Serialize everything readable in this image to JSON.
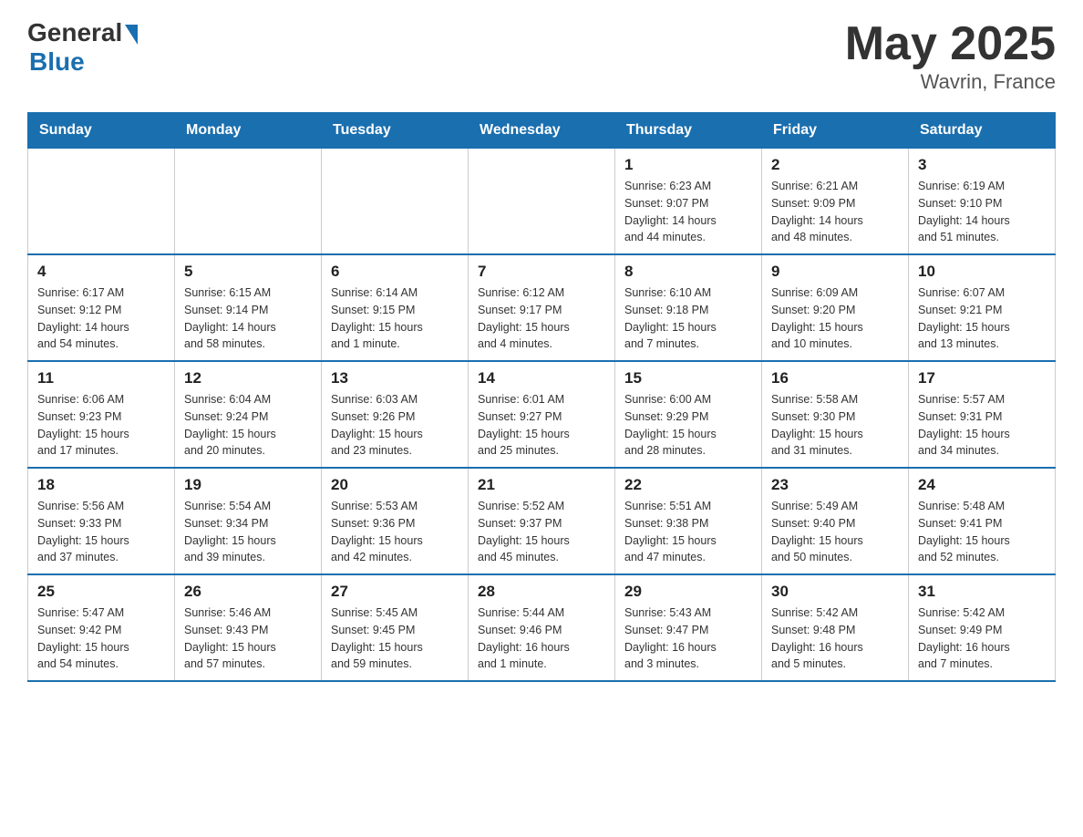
{
  "header": {
    "logo": {
      "general_text": "General",
      "blue_text": "Blue",
      "subtitle": "Blue"
    },
    "title": "May 2025",
    "location": "Wavrin, France"
  },
  "days_of_week": [
    "Sunday",
    "Monday",
    "Tuesday",
    "Wednesday",
    "Thursday",
    "Friday",
    "Saturday"
  ],
  "weeks": [
    {
      "days": [
        {
          "number": "",
          "info": ""
        },
        {
          "number": "",
          "info": ""
        },
        {
          "number": "",
          "info": ""
        },
        {
          "number": "",
          "info": ""
        },
        {
          "number": "1",
          "info": "Sunrise: 6:23 AM\nSunset: 9:07 PM\nDaylight: 14 hours\nand 44 minutes."
        },
        {
          "number": "2",
          "info": "Sunrise: 6:21 AM\nSunset: 9:09 PM\nDaylight: 14 hours\nand 48 minutes."
        },
        {
          "number": "3",
          "info": "Sunrise: 6:19 AM\nSunset: 9:10 PM\nDaylight: 14 hours\nand 51 minutes."
        }
      ]
    },
    {
      "days": [
        {
          "number": "4",
          "info": "Sunrise: 6:17 AM\nSunset: 9:12 PM\nDaylight: 14 hours\nand 54 minutes."
        },
        {
          "number": "5",
          "info": "Sunrise: 6:15 AM\nSunset: 9:14 PM\nDaylight: 14 hours\nand 58 minutes."
        },
        {
          "number": "6",
          "info": "Sunrise: 6:14 AM\nSunset: 9:15 PM\nDaylight: 15 hours\nand 1 minute."
        },
        {
          "number": "7",
          "info": "Sunrise: 6:12 AM\nSunset: 9:17 PM\nDaylight: 15 hours\nand 4 minutes."
        },
        {
          "number": "8",
          "info": "Sunrise: 6:10 AM\nSunset: 9:18 PM\nDaylight: 15 hours\nand 7 minutes."
        },
        {
          "number": "9",
          "info": "Sunrise: 6:09 AM\nSunset: 9:20 PM\nDaylight: 15 hours\nand 10 minutes."
        },
        {
          "number": "10",
          "info": "Sunrise: 6:07 AM\nSunset: 9:21 PM\nDaylight: 15 hours\nand 13 minutes."
        }
      ]
    },
    {
      "days": [
        {
          "number": "11",
          "info": "Sunrise: 6:06 AM\nSunset: 9:23 PM\nDaylight: 15 hours\nand 17 minutes."
        },
        {
          "number": "12",
          "info": "Sunrise: 6:04 AM\nSunset: 9:24 PM\nDaylight: 15 hours\nand 20 minutes."
        },
        {
          "number": "13",
          "info": "Sunrise: 6:03 AM\nSunset: 9:26 PM\nDaylight: 15 hours\nand 23 minutes."
        },
        {
          "number": "14",
          "info": "Sunrise: 6:01 AM\nSunset: 9:27 PM\nDaylight: 15 hours\nand 25 minutes."
        },
        {
          "number": "15",
          "info": "Sunrise: 6:00 AM\nSunset: 9:29 PM\nDaylight: 15 hours\nand 28 minutes."
        },
        {
          "number": "16",
          "info": "Sunrise: 5:58 AM\nSunset: 9:30 PM\nDaylight: 15 hours\nand 31 minutes."
        },
        {
          "number": "17",
          "info": "Sunrise: 5:57 AM\nSunset: 9:31 PM\nDaylight: 15 hours\nand 34 minutes."
        }
      ]
    },
    {
      "days": [
        {
          "number": "18",
          "info": "Sunrise: 5:56 AM\nSunset: 9:33 PM\nDaylight: 15 hours\nand 37 minutes."
        },
        {
          "number": "19",
          "info": "Sunrise: 5:54 AM\nSunset: 9:34 PM\nDaylight: 15 hours\nand 39 minutes."
        },
        {
          "number": "20",
          "info": "Sunrise: 5:53 AM\nSunset: 9:36 PM\nDaylight: 15 hours\nand 42 minutes."
        },
        {
          "number": "21",
          "info": "Sunrise: 5:52 AM\nSunset: 9:37 PM\nDaylight: 15 hours\nand 45 minutes."
        },
        {
          "number": "22",
          "info": "Sunrise: 5:51 AM\nSunset: 9:38 PM\nDaylight: 15 hours\nand 47 minutes."
        },
        {
          "number": "23",
          "info": "Sunrise: 5:49 AM\nSunset: 9:40 PM\nDaylight: 15 hours\nand 50 minutes."
        },
        {
          "number": "24",
          "info": "Sunrise: 5:48 AM\nSunset: 9:41 PM\nDaylight: 15 hours\nand 52 minutes."
        }
      ]
    },
    {
      "days": [
        {
          "number": "25",
          "info": "Sunrise: 5:47 AM\nSunset: 9:42 PM\nDaylight: 15 hours\nand 54 minutes."
        },
        {
          "number": "26",
          "info": "Sunrise: 5:46 AM\nSunset: 9:43 PM\nDaylight: 15 hours\nand 57 minutes."
        },
        {
          "number": "27",
          "info": "Sunrise: 5:45 AM\nSunset: 9:45 PM\nDaylight: 15 hours\nand 59 minutes."
        },
        {
          "number": "28",
          "info": "Sunrise: 5:44 AM\nSunset: 9:46 PM\nDaylight: 16 hours\nand 1 minute."
        },
        {
          "number": "29",
          "info": "Sunrise: 5:43 AM\nSunset: 9:47 PM\nDaylight: 16 hours\nand 3 minutes."
        },
        {
          "number": "30",
          "info": "Sunrise: 5:42 AM\nSunset: 9:48 PM\nDaylight: 16 hours\nand 5 minutes."
        },
        {
          "number": "31",
          "info": "Sunrise: 5:42 AM\nSunset: 9:49 PM\nDaylight: 16 hours\nand 7 minutes."
        }
      ]
    }
  ]
}
